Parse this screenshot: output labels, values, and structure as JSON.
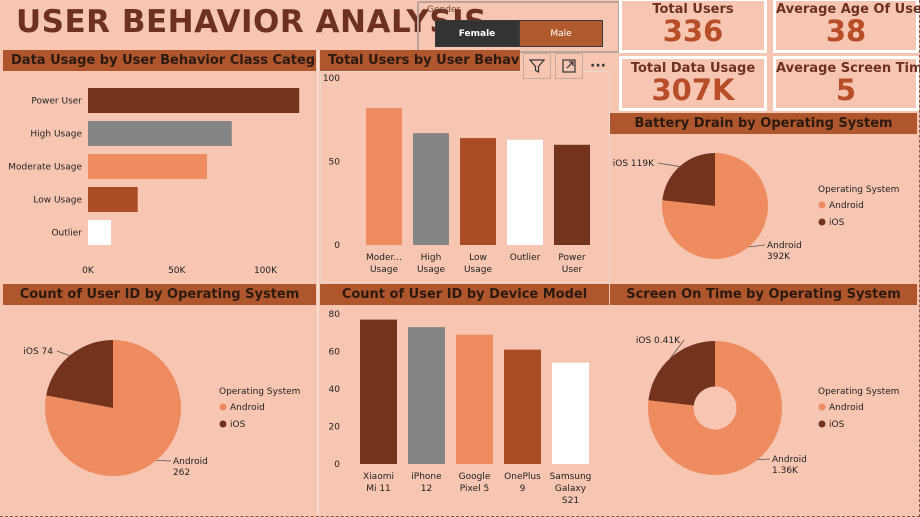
{
  "title": "USER BEHAVIOR ANALYSIS",
  "slicer": {
    "label": "Gender",
    "options": [
      "Female",
      "Male"
    ],
    "selected": "Female"
  },
  "kpis": [
    {
      "label": "Total Users",
      "value": "336"
    },
    {
      "label": "Average Age Of User",
      "value": "38"
    },
    {
      "label": "Total Data Usage",
      "value": "307K"
    },
    {
      "label": "Average Screen Time",
      "value": "5"
    }
  ],
  "colors": {
    "dark": "#73331d",
    "grey": "#858585",
    "orange": "#ee8c5f",
    "rust": "#ab4d24",
    "white": "#ffffff",
    "header": "#b0562c"
  },
  "chart_data": [
    {
      "id": "data-usage",
      "type": "bar",
      "orientation": "horizontal",
      "title": "Data Usage by User Behavior Class Category",
      "categories": [
        "Power User",
        "High Usage",
        "Moderate Usage",
        "Low Usage",
        "Outlier"
      ],
      "values": [
        119000,
        81000,
        67000,
        28000,
        13000
      ],
      "bar_colors": [
        "#73331d",
        "#858585",
        "#ee8c5f",
        "#ab4d24",
        "#ffffff"
      ],
      "xticks": [
        "0K",
        "50K",
        "100K"
      ],
      "xtick_values": [
        0,
        50000,
        100000
      ],
      "xlim": [
        0,
        120000
      ]
    },
    {
      "id": "total-users",
      "type": "bar",
      "title": "Total Users by User Behavior Class Category",
      "categories": [
        [
          "Moder...",
          "Usage"
        ],
        [
          "High",
          "Usage"
        ],
        [
          "Low",
          "Usage"
        ],
        [
          "Outlier"
        ],
        [
          "Power",
          "User"
        ]
      ],
      "values": [
        82,
        67,
        64,
        63,
        60
      ],
      "bar_colors": [
        "#ee8c5f",
        "#858585",
        "#ab4d24",
        "#ffffff",
        "#73331d"
      ],
      "yticks": [
        0,
        50,
        100
      ],
      "ylim": [
        0,
        100
      ]
    },
    {
      "id": "battery-drain",
      "type": "pie",
      "title": "Battery Drain by Operating System",
      "slices": [
        {
          "label": "Android",
          "value_label": "392K",
          "value": 392,
          "color": "#ee8c5f"
        },
        {
          "label": "iOS",
          "value_label": "119K",
          "value": 119,
          "color": "#73331d"
        }
      ],
      "legend_title": "Operating System",
      "legend": [
        "Android",
        "iOS"
      ],
      "donut": false
    },
    {
      "id": "count-os",
      "type": "pie",
      "title": "Count of User ID by Operating System",
      "slices": [
        {
          "label": "Android",
          "value_label": "262",
          "value": 262,
          "color": "#ee8c5f"
        },
        {
          "label": "iOS",
          "value_label": "74",
          "value": 74,
          "color": "#73331d"
        }
      ],
      "legend_title": "Operating System",
      "legend": [
        "Android",
        "iOS"
      ],
      "donut": false
    },
    {
      "id": "device-model",
      "type": "bar",
      "title": "Count of User ID by Device Model",
      "categories": [
        [
          "Xiaomi",
          "Mi 11"
        ],
        [
          "iPhone",
          "12"
        ],
        [
          "Google",
          "Pixel 5"
        ],
        [
          "OnePlus",
          "9"
        ],
        [
          "Samsung",
          "Galaxy",
          "S21"
        ]
      ],
      "values": [
        77,
        73,
        69,
        61,
        54
      ],
      "bar_colors": [
        "#73331d",
        "#858585",
        "#ee8c5f",
        "#ab4d24",
        "#ffffff"
      ],
      "yticks": [
        0,
        20,
        40,
        60,
        80
      ],
      "ylim": [
        0,
        80
      ]
    },
    {
      "id": "screen-on",
      "type": "pie",
      "title": "Screen On Time by Operating System",
      "slices": [
        {
          "label": "Android",
          "value_label": "1.36K",
          "value": 1.36,
          "color": "#ee8c5f"
        },
        {
          "label": "iOS",
          "value_label": "0.41K",
          "value": 0.41,
          "color": "#73331d"
        }
      ],
      "legend_title": "Operating System",
      "legend": [
        "Android",
        "iOS"
      ],
      "donut": true
    }
  ]
}
